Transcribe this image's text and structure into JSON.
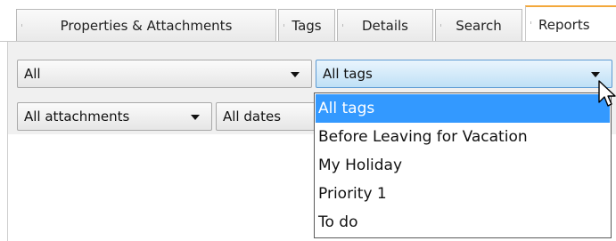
{
  "tabs": [
    {
      "label": "Properties & Attachments"
    },
    {
      "label": "Tags"
    },
    {
      "label": "Details"
    },
    {
      "label": "Search"
    },
    {
      "label": "Reports"
    }
  ],
  "filters": {
    "scope": {
      "value": "All"
    },
    "tags": {
      "value": "All tags"
    },
    "attachments": {
      "value": "All attachments"
    },
    "dates": {
      "value": "All dates"
    }
  },
  "tag_options": [
    {
      "label": "All tags",
      "selected": true
    },
    {
      "label": "Before Leaving for Vacation",
      "selected": false
    },
    {
      "label": "My Holiday",
      "selected": false
    },
    {
      "label": "Priority 1",
      "selected": false
    },
    {
      "label": "To do",
      "selected": false
    }
  ],
  "colors": {
    "active_tab_accent": "#f3a83b",
    "selection": "#3399ff",
    "hover_combo": "#bfe0f6"
  }
}
